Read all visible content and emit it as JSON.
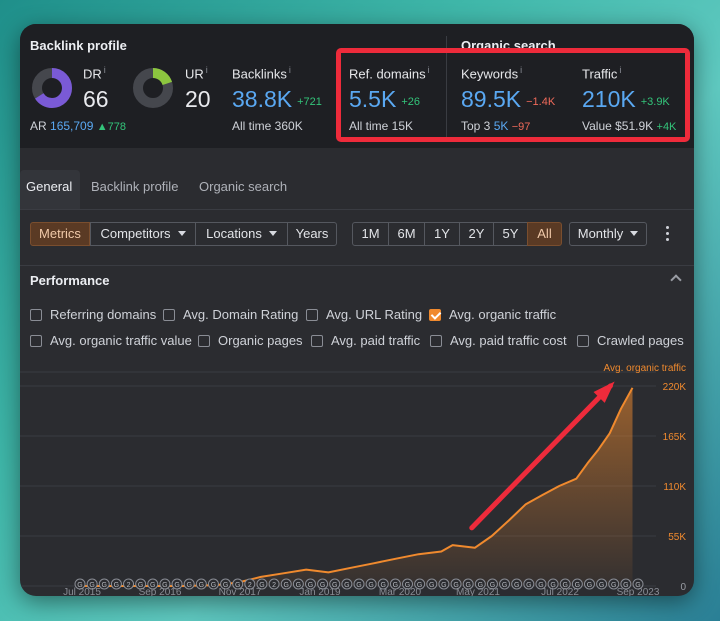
{
  "backlink_profile": {
    "title": "Backlink profile",
    "dr": {
      "label": "DR",
      "info": "i",
      "value": "66",
      "ring_fraction": 0.66
    },
    "ar": {
      "label": "AR",
      "value": "165,709",
      "delta": "▲778"
    },
    "ur": {
      "label": "UR",
      "info": "i",
      "value": "20",
      "ring_fraction": 0.2
    },
    "backlinks": {
      "label": "Backlinks",
      "info": "i",
      "value": "38.8K",
      "delta": "+721",
      "sub": "All time 360K"
    },
    "ref_domains": {
      "label": "Ref. domains",
      "info": "i",
      "value": "5.5K",
      "delta": "+26",
      "sub": "All time 15K"
    }
  },
  "organic_search": {
    "title": "Organic search",
    "keywords": {
      "label": "Keywords",
      "info": "i",
      "value": "89.5K",
      "delta": "−1.4K",
      "sub_label": "Top 3",
      "sub_value": "5K",
      "sub_delta": "−97"
    },
    "traffic": {
      "label": "Traffic",
      "info": "i",
      "value": "210K",
      "delta": "+3.9K",
      "sub": "Value $51.9K",
      "sub_delta": "+4K"
    }
  },
  "tabs": [
    {
      "label": "General",
      "active": true
    },
    {
      "label": "Backlink profile",
      "active": false
    },
    {
      "label": "Organic search",
      "active": false
    }
  ],
  "toolbar": {
    "filters": [
      {
        "label": "Metrics",
        "active": true,
        "dropdown": false
      },
      {
        "label": "Competitors",
        "active": false,
        "dropdown": true
      },
      {
        "label": "Locations",
        "active": false,
        "dropdown": true
      },
      {
        "label": "Years",
        "active": false,
        "dropdown": false
      }
    ],
    "ranges": [
      {
        "label": "1M",
        "active": false
      },
      {
        "label": "6M",
        "active": false
      },
      {
        "label": "1Y",
        "active": false
      },
      {
        "label": "2Y",
        "active": false
      },
      {
        "label": "5Y",
        "active": false
      },
      {
        "label": "All",
        "active": true
      }
    ],
    "interval": "Monthly"
  },
  "performance": {
    "title": "Performance",
    "checkboxes": [
      {
        "label": "Referring domains",
        "checked": false
      },
      {
        "label": "Avg. Domain Rating",
        "checked": false
      },
      {
        "label": "Avg. URL Rating",
        "checked": false
      },
      {
        "label": "Avg. organic traffic",
        "checked": true
      },
      {
        "label": "Avg. organic traffic value",
        "checked": false
      },
      {
        "label": "Organic pages",
        "checked": false
      },
      {
        "label": "Avg. paid traffic",
        "checked": false
      },
      {
        "label": "Avg. paid traffic cost",
        "checked": false
      },
      {
        "label": "Crawled pages",
        "checked": false
      }
    ]
  },
  "colors": {
    "accent": "#f08a2e",
    "blue": "#5aa8f2",
    "green": "#33c47a",
    "red": "#f06a5a",
    "highlight": "#ee2b3b"
  },
  "chart_data": {
    "type": "area",
    "series": [
      {
        "name": "Avg. organic traffic",
        "color": "#f08a2e"
      }
    ],
    "x_ticks": [
      "Jul 2015",
      "Sep 2016",
      "Nov 2017",
      "Jan 2019",
      "Mar 2020",
      "May 2021",
      "Jul 2022",
      "Sep 2023"
    ],
    "y_ticks": [
      "220K",
      "165K",
      "110K",
      "55K",
      "0"
    ],
    "ylim": [
      0,
      220000
    ],
    "x": [
      "2015-07",
      "2016-01",
      "2016-07",
      "2017-01",
      "2017-07",
      "2017-11",
      "2018-03",
      "2018-07",
      "2018-11",
      "2019-03",
      "2019-07",
      "2019-11",
      "2020-03",
      "2020-07",
      "2020-11",
      "2021-01",
      "2021-05",
      "2021-08",
      "2021-11",
      "2022-02",
      "2022-05",
      "2022-08",
      "2022-11",
      "2023-01",
      "2023-03",
      "2023-05",
      "2023-07",
      "2023-09"
    ],
    "values": [
      0,
      0,
      0,
      0,
      1000,
      4000,
      10000,
      14000,
      18000,
      15000,
      20000,
      25000,
      30000,
      35000,
      38000,
      45000,
      42000,
      55000,
      72000,
      90000,
      100000,
      110000,
      118000,
      135000,
      150000,
      168000,
      195000,
      218000
    ],
    "annotation_markers": [
      "G",
      "G",
      "G",
      "G",
      "2",
      "G",
      "G",
      "G",
      "G",
      "G",
      "G",
      "G",
      "G",
      "G",
      "2",
      "G",
      "2",
      "G",
      "G",
      "G",
      "G",
      "G",
      "G",
      "G",
      "G",
      "G",
      "G",
      "G",
      "G",
      "G",
      "G",
      "G",
      "G",
      "G",
      "G",
      "G",
      "G",
      "G",
      "G",
      "G",
      "G",
      "G",
      "G",
      "G",
      "G",
      "G",
      "G"
    ],
    "arrow": {
      "from": "2021-05",
      "to": "2023-09",
      "color": "#ee2b3b"
    }
  }
}
